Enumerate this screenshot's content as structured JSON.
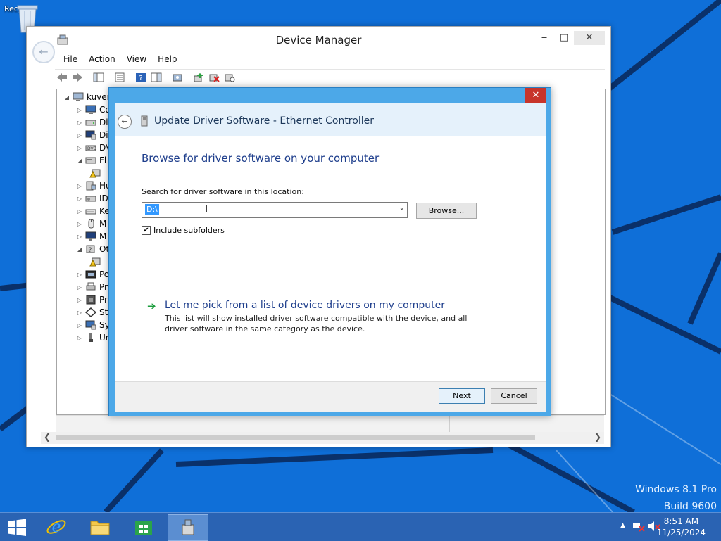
{
  "desktop": {
    "recycle_bin_label": "Recyc",
    "branding_line1": "Windows 8.1 Pro",
    "branding_line2": "Build 9600"
  },
  "device_manager": {
    "title": "Device Manager",
    "menu": [
      "File",
      "Action",
      "View",
      "Help"
    ],
    "tree": {
      "root": "kuver",
      "items": [
        {
          "label": "Co",
          "icon": "computer-icon"
        },
        {
          "label": "Di",
          "icon": "disk-drive-icon"
        },
        {
          "label": "Di",
          "icon": "display-adapter-icon"
        },
        {
          "label": "DV",
          "icon": "dvd-drive-icon"
        },
        {
          "label": "Fl",
          "icon": "floppy-controller-icon",
          "expanded": true
        },
        {
          "label": "",
          "icon": "warning-device-icon",
          "child": true
        },
        {
          "label": "Hu",
          "icon": "hid-icon"
        },
        {
          "label": "ID",
          "icon": "ide-controller-icon"
        },
        {
          "label": "Ke",
          "icon": "keyboard-icon"
        },
        {
          "label": "M",
          "icon": "mouse-icon"
        },
        {
          "label": "M",
          "icon": "monitor-icon"
        },
        {
          "label": "Ot",
          "icon": "other-devices-icon",
          "expanded": true
        },
        {
          "label": "",
          "icon": "unknown-device-icon",
          "child": true
        },
        {
          "label": "Po",
          "icon": "ports-icon"
        },
        {
          "label": "Pr",
          "icon": "print-queue-icon"
        },
        {
          "label": "Pr",
          "icon": "processor-icon"
        },
        {
          "label": "St",
          "icon": "storage-controller-icon"
        },
        {
          "label": "Sy",
          "icon": "system-devices-icon"
        },
        {
          "label": "Ur",
          "icon": "usb-controller-icon"
        }
      ]
    }
  },
  "update_driver": {
    "title": "Update Driver Software - Ethernet Controller",
    "heading": "Browse for driver software on your computer",
    "search_label": "Search for driver software in this location:",
    "path_value": "D:\\",
    "browse_label": "Browse...",
    "include_subfolders_label": "Include subfolders",
    "include_subfolders_checked": true,
    "pick_title": "Let me pick from a list of device drivers on my computer",
    "pick_desc": "This list will show installed driver software compatible with the device, and all driver software in the same category as the device.",
    "next_label": "Next",
    "cancel_label": "Cancel"
  },
  "taskbar": {
    "time": "8:51 AM",
    "date": "11/25/2024"
  }
}
